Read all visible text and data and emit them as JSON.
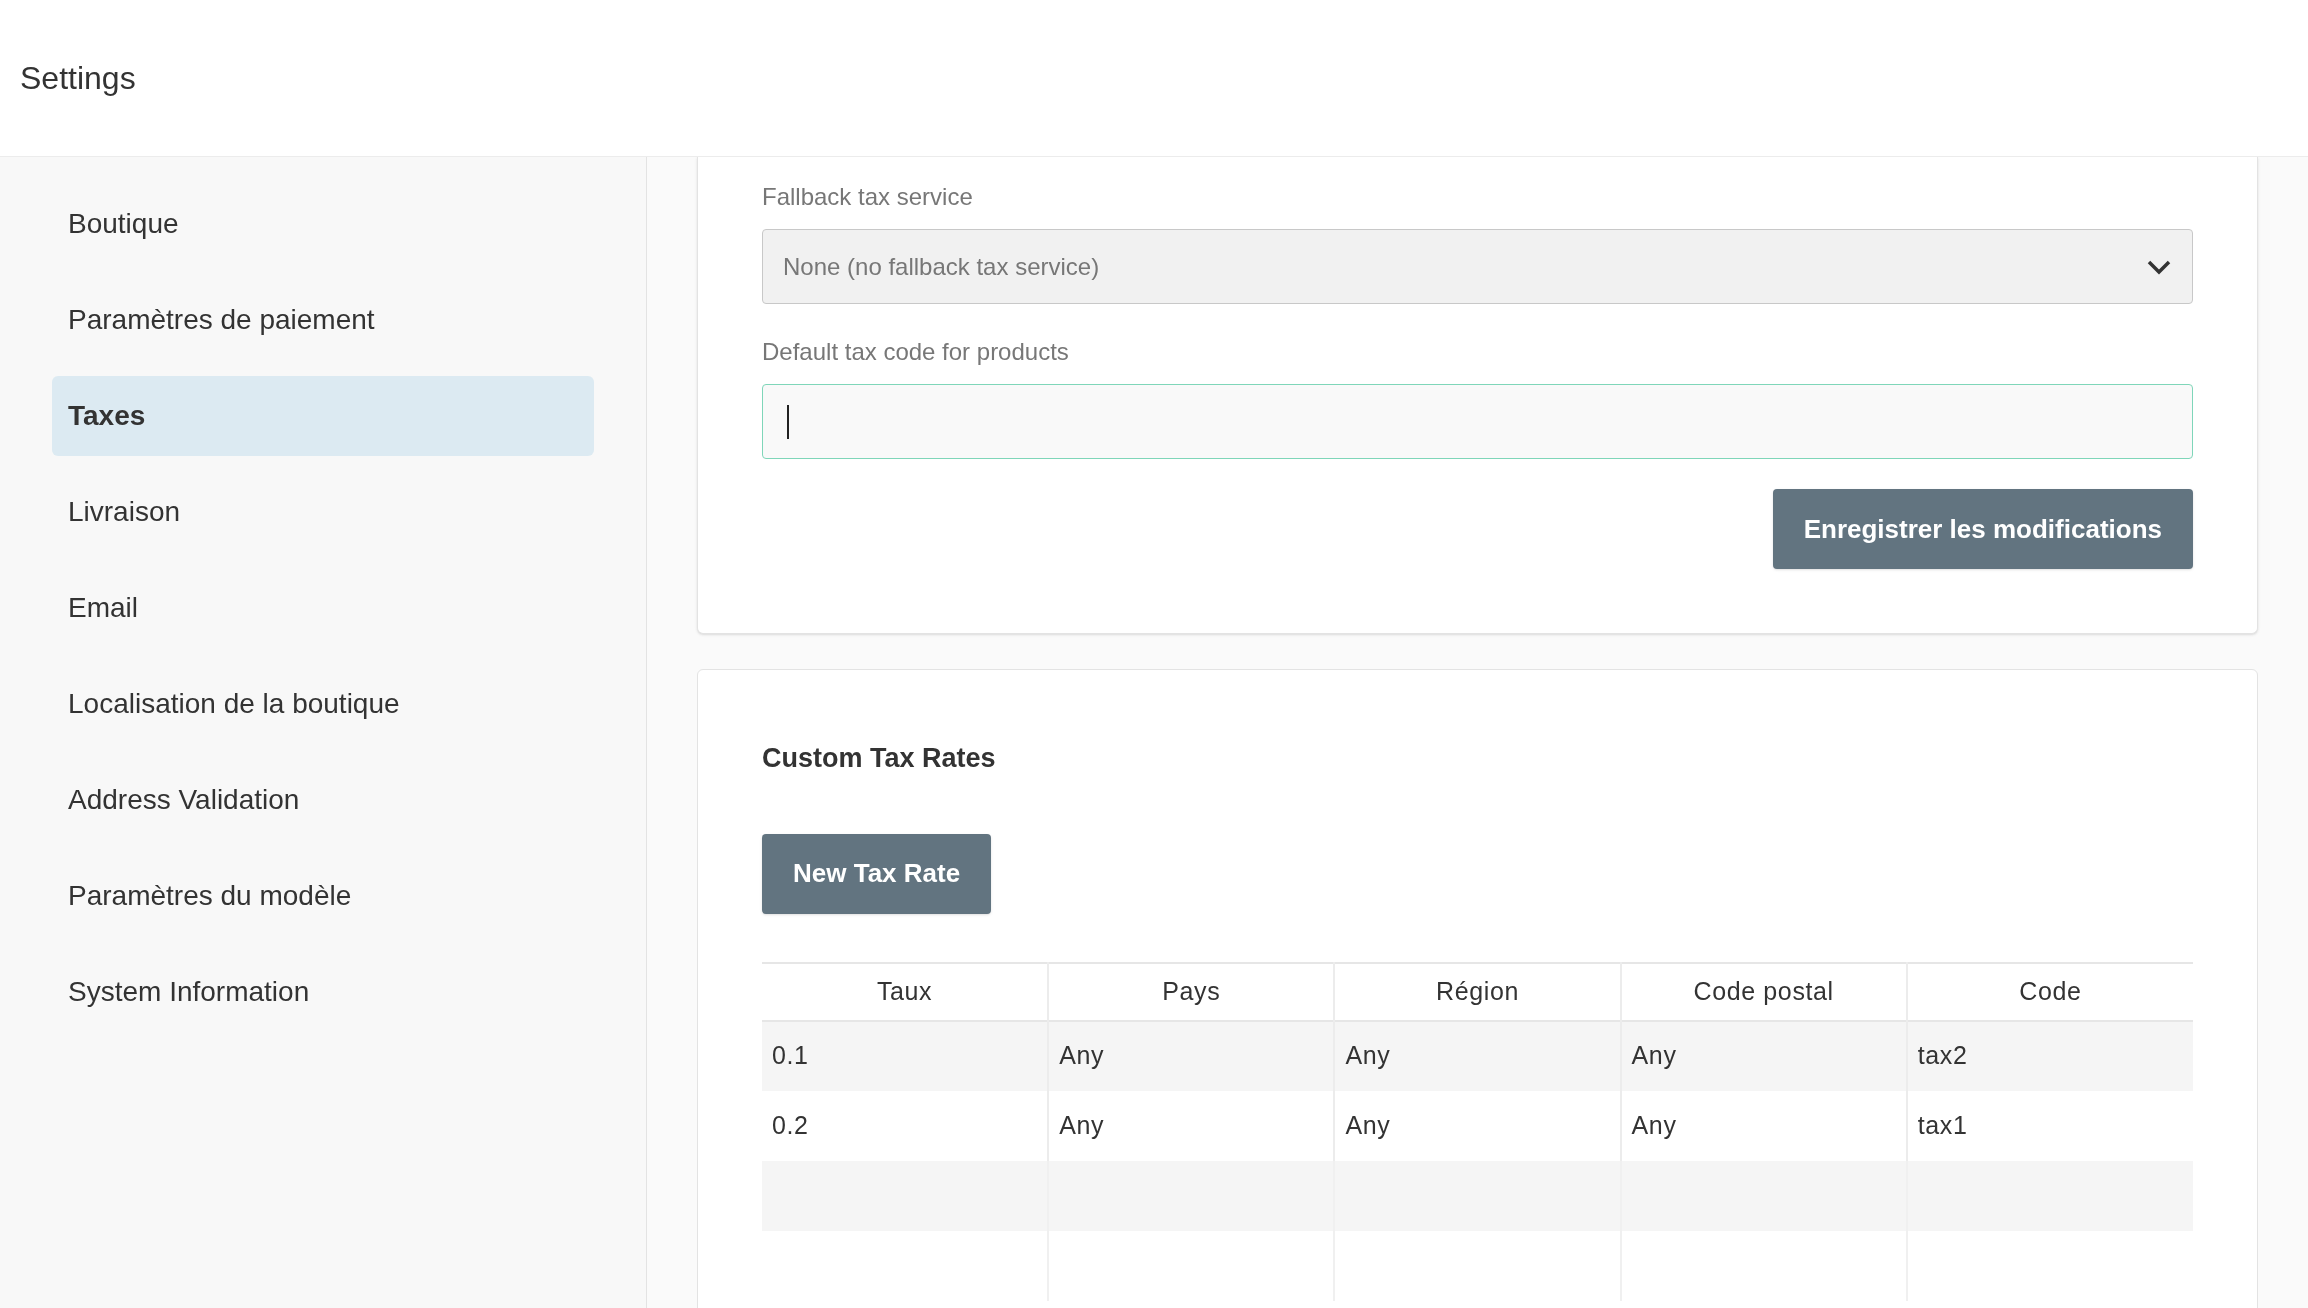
{
  "header": {
    "title": "Settings"
  },
  "sidebar": {
    "items": [
      {
        "label": "Boutique",
        "selected": false
      },
      {
        "label": "Paramètres de paiement",
        "selected": false
      },
      {
        "label": "Taxes",
        "selected": true
      },
      {
        "label": "Livraison",
        "selected": false
      },
      {
        "label": "Email",
        "selected": false
      },
      {
        "label": "Localisation de la boutique",
        "selected": false
      },
      {
        "label": "Address Validation",
        "selected": false
      },
      {
        "label": "Paramètres du modèle",
        "selected": false
      },
      {
        "label": "System Information",
        "selected": false
      }
    ]
  },
  "tax_settings": {
    "fallback_label": "Fallback tax service",
    "fallback_value": "None (no fallback tax service)",
    "default_code_label": "Default tax code for products",
    "default_code_focused": true,
    "save_button": "Enregistrer les modifications"
  },
  "custom_tax_rates": {
    "title": "Custom Tax Rates",
    "new_button": "New Tax Rate",
    "table": {
      "columns": [
        "Taux",
        "Pays",
        "Région",
        "Code postal",
        "Code"
      ],
      "rows": [
        [
          "0.1",
          "Any",
          "Any",
          "Any",
          "tax2"
        ],
        [
          "0.2",
          "Any",
          "Any",
          "Any",
          "tax1"
        ]
      ]
    }
  }
}
